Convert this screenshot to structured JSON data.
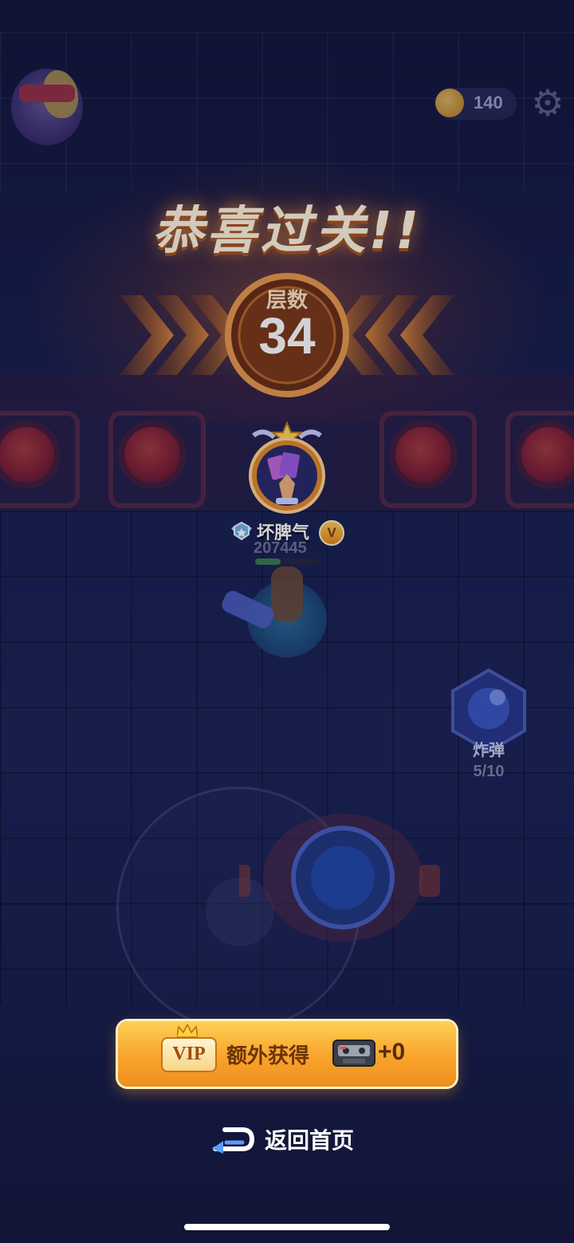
{
  "header": {
    "coins": "140"
  },
  "result": {
    "title": "恭喜过关!!",
    "floor_label": "层数",
    "floor_number": "34"
  },
  "player": {
    "name": "坏脾气",
    "vip_badge": "V",
    "score": "207445",
    "hp_fraction": 0.4
  },
  "skill": {
    "label": "炸弹",
    "count": "5/10"
  },
  "actions": {
    "vip_logo": "VIP",
    "vip_reward_text": "额外获得",
    "vip_reward_value": "+0",
    "home_label": "返回首页"
  },
  "colors": {
    "accent_orange": "#f8a32c",
    "title_glow": "#a8531c",
    "background": "#141a3c"
  },
  "icons": [
    "settings-gear-icon",
    "coin-icon",
    "rank-badge-icon",
    "vip-crown-icon",
    "cassette-tape-icon",
    "return-arrow-icon",
    "bomb-icon"
  ]
}
